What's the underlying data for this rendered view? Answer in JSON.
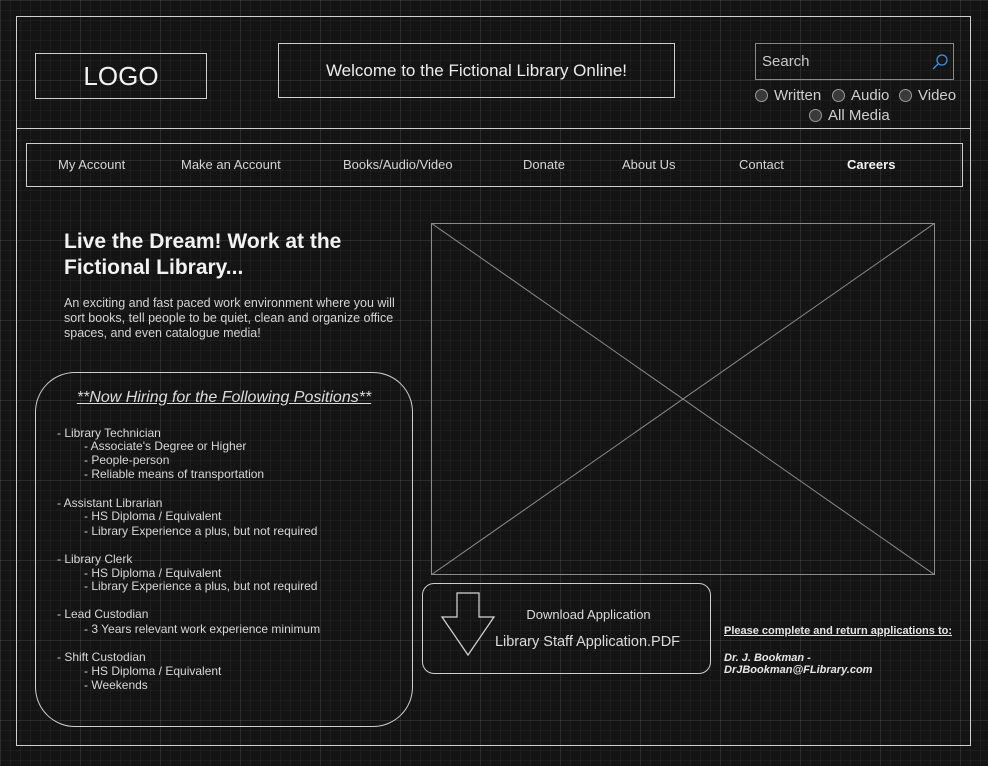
{
  "header": {
    "logo_text": "LOGO",
    "welcome_text": "Welcome to the Fictional Library Online!"
  },
  "search": {
    "placeholder": "Search",
    "filters": [
      "Written",
      "Audio",
      "Video",
      "All Media"
    ]
  },
  "nav": {
    "items": [
      "My Account",
      "Make an Account",
      "Books/Audio/Video",
      "Donate",
      "About Us",
      "Contact",
      "Careers"
    ],
    "active": "Careers"
  },
  "main": {
    "headline": "Live the Dream! Work at the Fictional Library...",
    "intro": "An exciting and fast paced work environment where you will sort books, tell people to be quiet, clean and organize office spaces, and even catalogue media!"
  },
  "hiring": {
    "title": "**Now Hiring for the Following Positions**",
    "positions": [
      {
        "title": "- Library Technician",
        "requirements": [
          "- Associate's Degree or Higher",
          "- People-person",
          "- Reliable means of transportation"
        ]
      },
      {
        "title": "- Assistant Librarian",
        "requirements": [
          "- HS Diploma / Equivalent",
          "- Library Experience a plus, but not required"
        ]
      },
      {
        "title": "- Library Clerk",
        "requirements": [
          "- HS Diploma / Equivalent",
          "- Library Experience a plus, but not required"
        ]
      },
      {
        "title": "- Lead Custodian",
        "requirements": [
          "- 3 Years relevant work experience minimum"
        ]
      },
      {
        "title": "- Shift Custodian",
        "requirements": [
          "- HS Diploma / Equivalent",
          "- Weekends"
        ]
      }
    ]
  },
  "download": {
    "title": "Download Application",
    "file": "Library Staff Application.PDF"
  },
  "application": {
    "note": "Please complete and return applications to:",
    "contact_name": "Dr. J. Bookman -",
    "contact_email": "DrJBookman@FLibrary.com"
  },
  "icons": {
    "search": "search-icon",
    "download": "download-arrow-icon",
    "image": "image-placeholder-icon"
  }
}
